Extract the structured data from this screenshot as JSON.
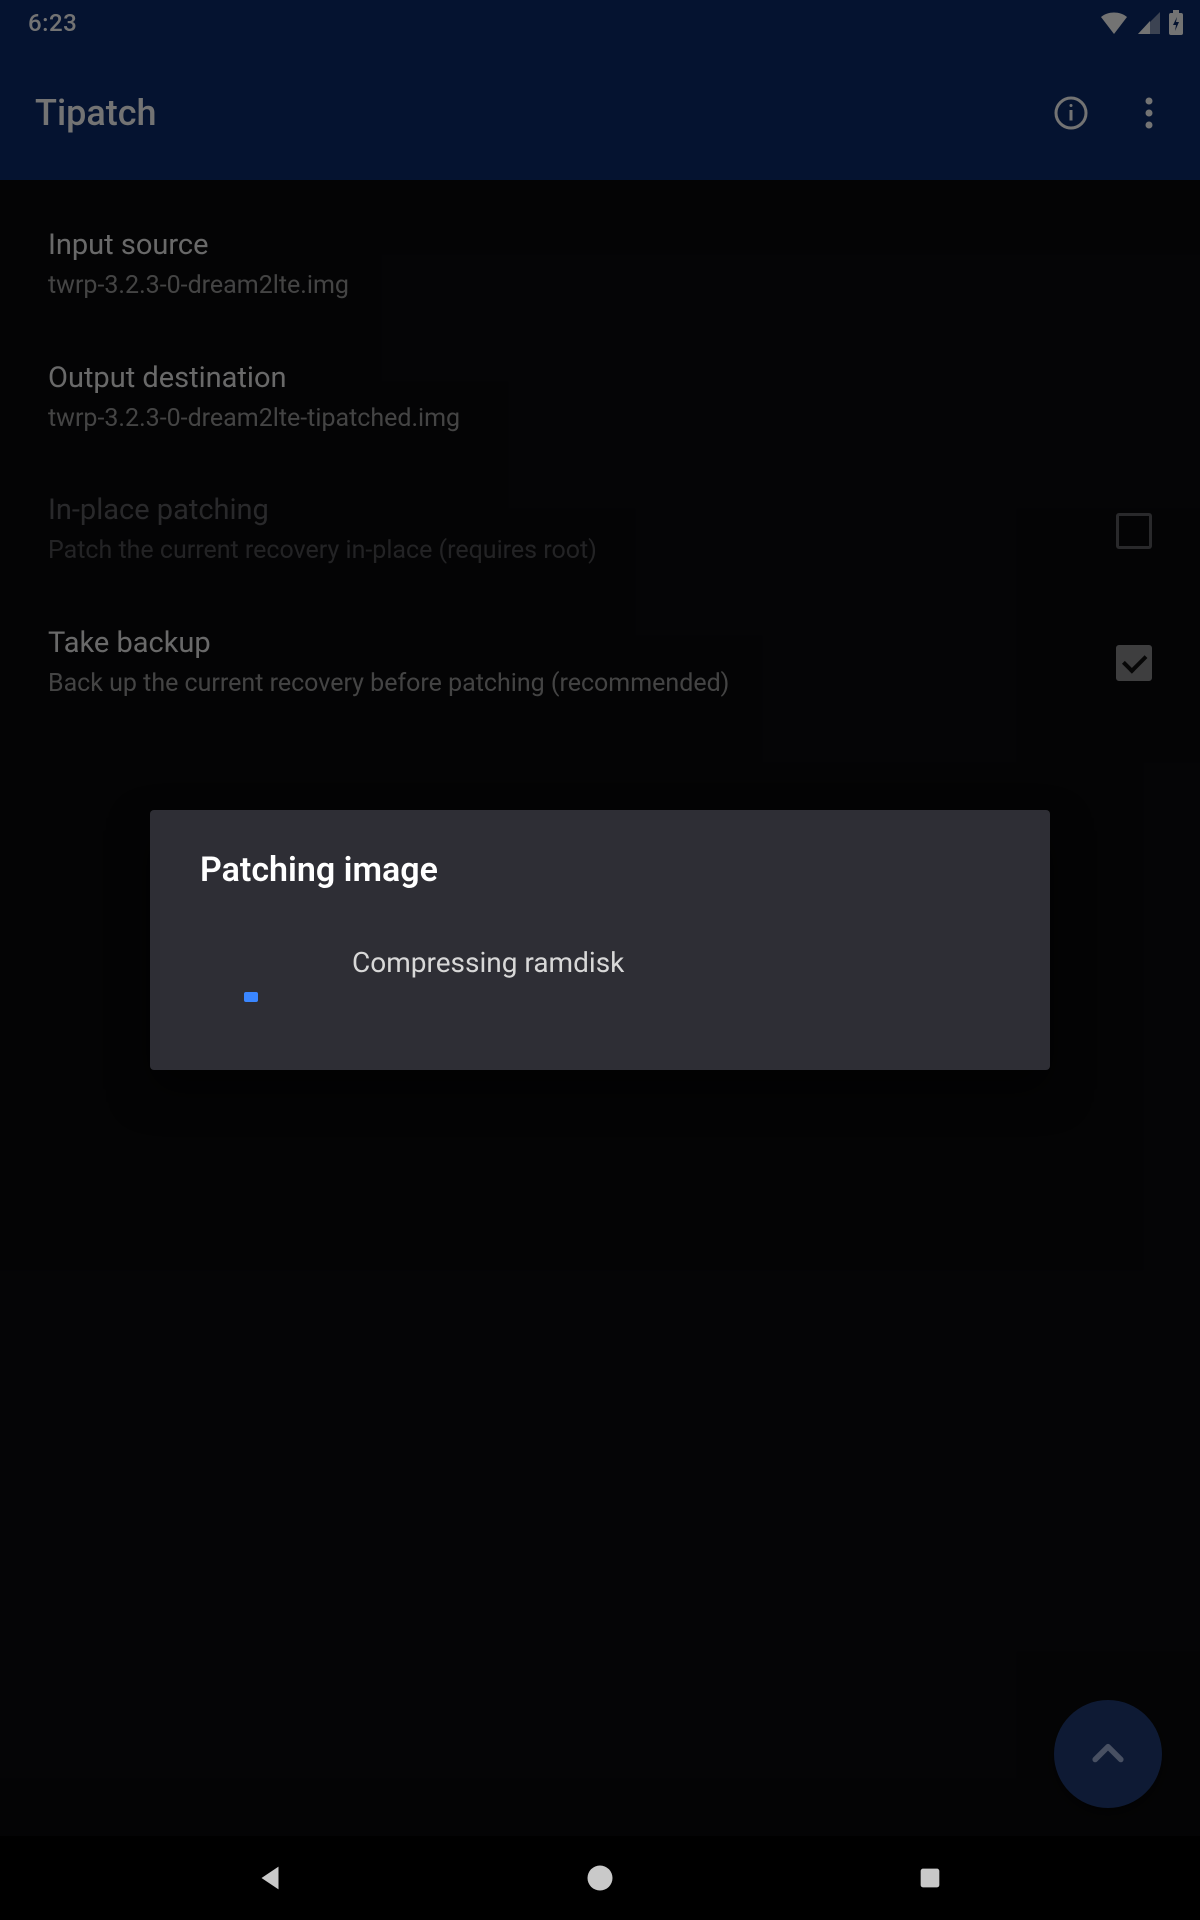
{
  "status": {
    "time": "6:23"
  },
  "appbar": {
    "title": "Tipatch"
  },
  "prefs": {
    "input": {
      "title": "Input source",
      "sub": "twrp-3.2.3-0-dream2lte.img"
    },
    "output": {
      "title": "Output destination",
      "sub": "twrp-3.2.3-0-dream2lte-tipatched.img"
    },
    "inplace": {
      "title": "In-place patching",
      "sub": "Patch the current recovery in-place (requires root)",
      "checked": false
    },
    "backup": {
      "title": "Take backup",
      "sub": "Back up the current recovery before patching (recommended)",
      "checked": true
    }
  },
  "dialog": {
    "title": "Patching image",
    "message": "Compressing ramdisk"
  }
}
